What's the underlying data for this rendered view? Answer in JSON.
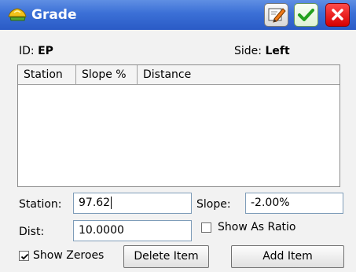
{
  "window": {
    "title": "Grade",
    "icon": "grade-app-icon"
  },
  "titlebar_buttons": {
    "edit": "edit-icon",
    "ok": "checkmark-icon",
    "close": "close-icon"
  },
  "header": {
    "id_label": "ID:",
    "id_value": "EP",
    "side_label": "Side:",
    "side_value": "Left"
  },
  "table": {
    "columns": [
      "Station",
      "Slope %",
      "Distance"
    ],
    "rows": []
  },
  "form": {
    "station_label": "Station:",
    "station_value": "97.62",
    "slope_label": "Slope:",
    "slope_value": "-2.00%",
    "dist_label": "Dist:",
    "dist_value": "10.0000",
    "show_as_ratio_label": "Show As Ratio",
    "show_as_ratio_checked": false,
    "show_zeroes_label": "Show Zeroes",
    "show_zeroes_checked": true
  },
  "buttons": {
    "delete_item": "Delete Item",
    "add_item": "Add Item"
  },
  "colors": {
    "titlebar": "#3b6fd6",
    "ok_button": "#2aa02a",
    "close_button": "#d60000"
  }
}
